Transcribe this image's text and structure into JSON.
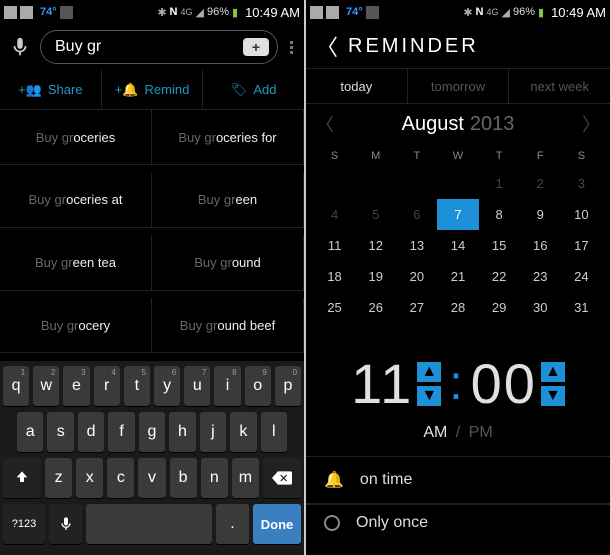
{
  "statusbar": {
    "temp": "74°",
    "battery": "96%",
    "time": "10:49 AM"
  },
  "search": {
    "value": "Buy gr"
  },
  "actions": {
    "share": "Share",
    "remind": "Remind",
    "add": "Add"
  },
  "suggestions": [
    {
      "pre": "Buy gr",
      "rest": "oceries"
    },
    {
      "pre": "Buy gr",
      "rest": "oceries for"
    },
    {
      "pre": "Buy gr",
      "rest": "oceries at"
    },
    {
      "pre": "Buy gr",
      "rest": "een"
    },
    {
      "pre": "Buy gr",
      "rest": "een tea"
    },
    {
      "pre": "Buy gr",
      "rest": "ound"
    },
    {
      "pre": "Buy gr",
      "rest": "ocery"
    },
    {
      "pre": "Buy gr",
      "rest": "ound beef"
    }
  ],
  "keyboard": {
    "row1": [
      "q",
      "w",
      "e",
      "r",
      "t",
      "y",
      "u",
      "i",
      "o",
      "p"
    ],
    "nums": [
      "1",
      "2",
      "3",
      "4",
      "5",
      "6",
      "7",
      "8",
      "9",
      "0"
    ],
    "row2": [
      "a",
      "s",
      "d",
      "f",
      "g",
      "h",
      "j",
      "k",
      "l"
    ],
    "row3": [
      "z",
      "x",
      "c",
      "v",
      "b",
      "n",
      "m"
    ],
    "fn": "?123",
    "dot": ".",
    "done": "Done"
  },
  "reminder": {
    "title": "REMINDER",
    "tabs": {
      "today": "today",
      "tomorrow": "tomorrow",
      "nextweek": "next week"
    },
    "month": "August",
    "year": "2013",
    "dow": [
      "S",
      "M",
      "T",
      "W",
      "T",
      "F",
      "S"
    ],
    "days_dim_prev": [
      "",
      "",
      "",
      "",
      "1",
      "2",
      "3"
    ],
    "weeks": [
      [
        "4",
        "5",
        "6",
        "7",
        "8",
        "9",
        "10"
      ],
      [
        "11",
        "12",
        "13",
        "14",
        "15",
        "16",
        "17"
      ],
      [
        "18",
        "19",
        "20",
        "21",
        "22",
        "23",
        "24"
      ],
      [
        "25",
        "26",
        "27",
        "28",
        "29",
        "30",
        "31"
      ]
    ],
    "selected_day": "7",
    "hour": "11",
    "minute": "00",
    "am": "AM",
    "pm": "PM",
    "opt_ontime": "on time",
    "opt_once": "Only once"
  }
}
